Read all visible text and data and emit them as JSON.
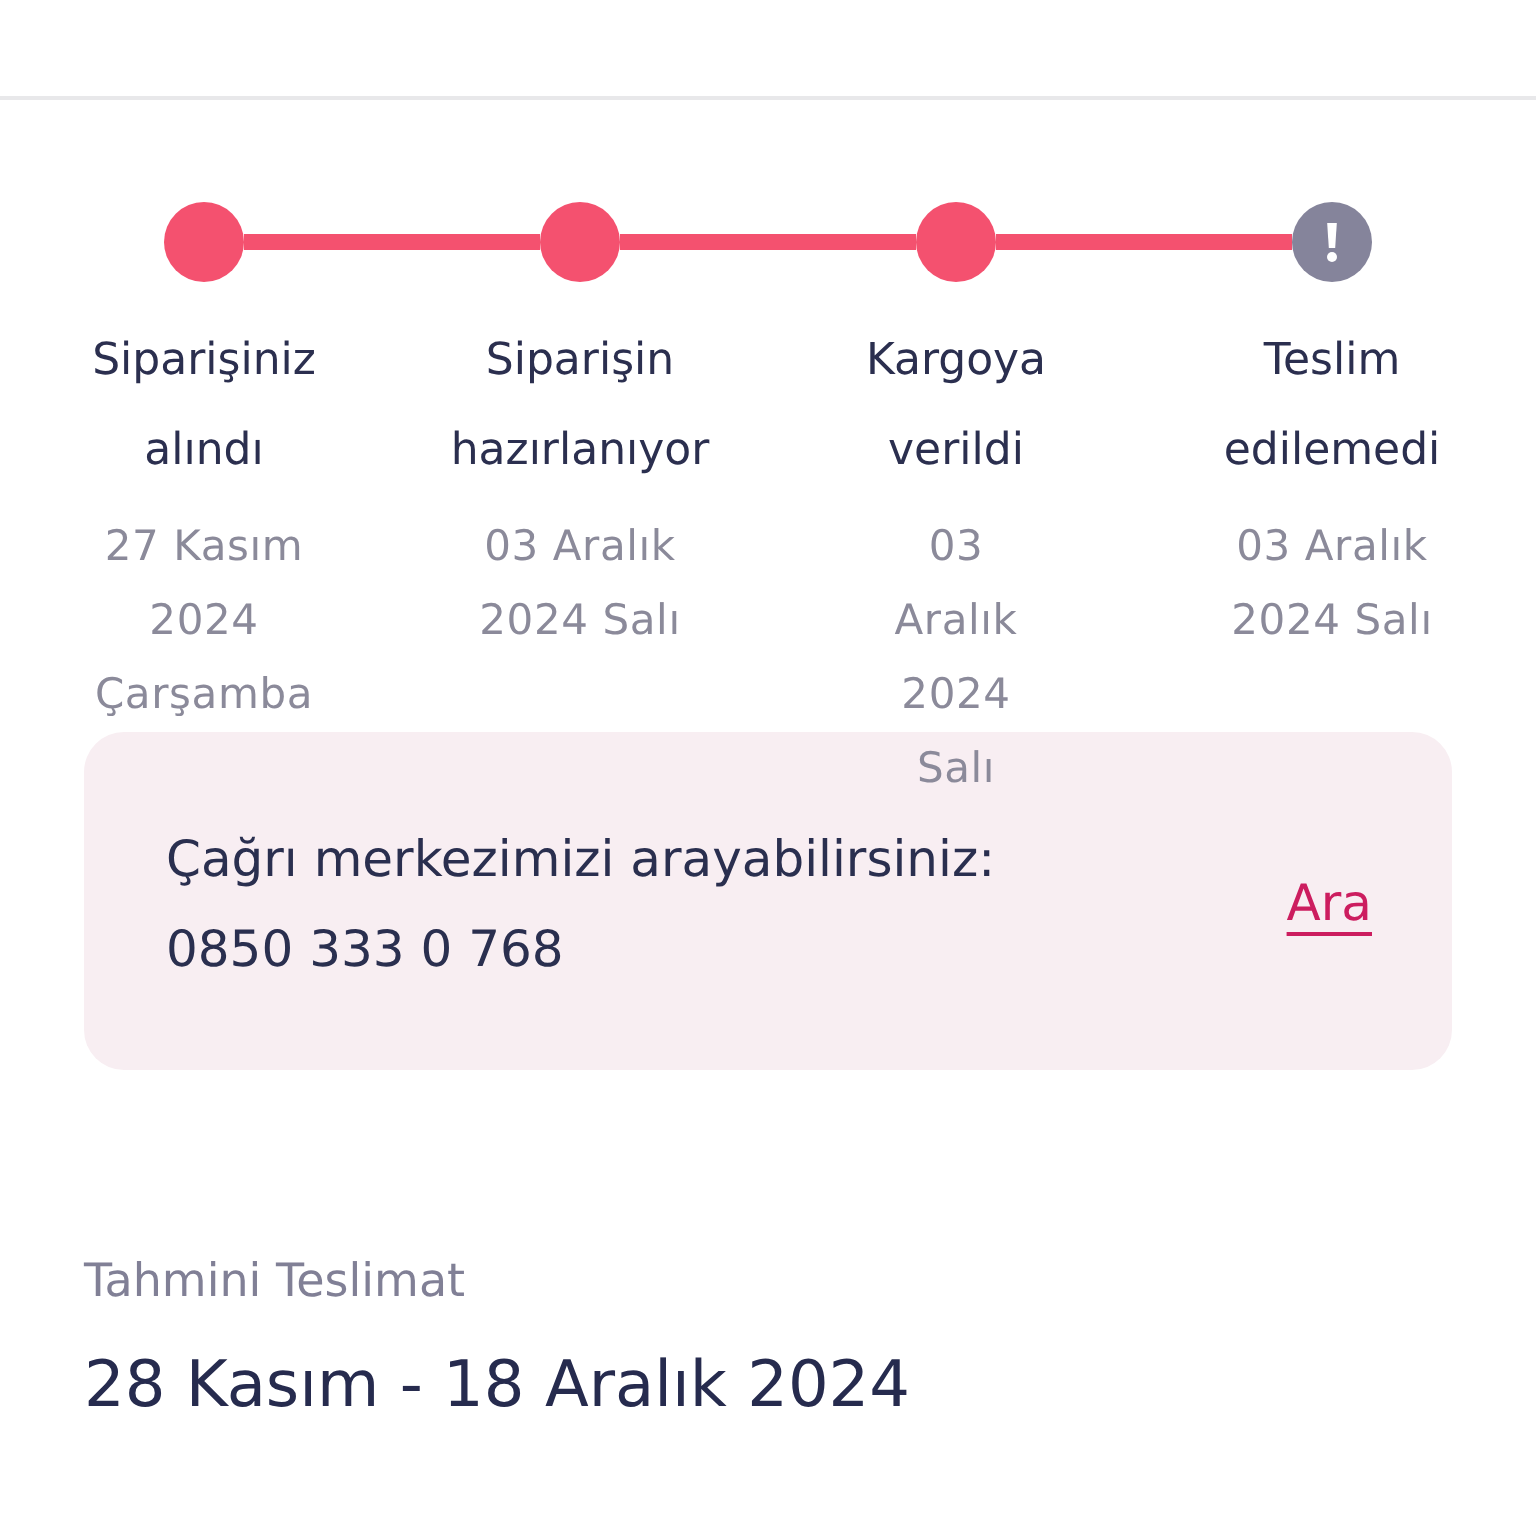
{
  "steps": [
    {
      "title": "Siparişiniz alındı",
      "date": "27 Kasım 2024 Çarşamba",
      "kind": "done"
    },
    {
      "title": "Siparişin hazırlanıyor",
      "date": "03 Aralık 2024 Salı",
      "kind": "done"
    },
    {
      "title": "Kargoya verildi",
      "date": "03 Aralık 2024 Salı",
      "kind": "done"
    },
    {
      "title": "Teslim edilemedi",
      "date": "03 Aralık 2024 Salı",
      "kind": "failed"
    }
  ],
  "call_center": {
    "message": "Çağrı merkezimizi arayabilirsiniz:",
    "phone": "0850 333 0 768",
    "action": "Ara"
  },
  "estimated_delivery": {
    "label": "Tahmini Teslimat",
    "value": "28 Kasım - 18 Aralık 2024"
  }
}
